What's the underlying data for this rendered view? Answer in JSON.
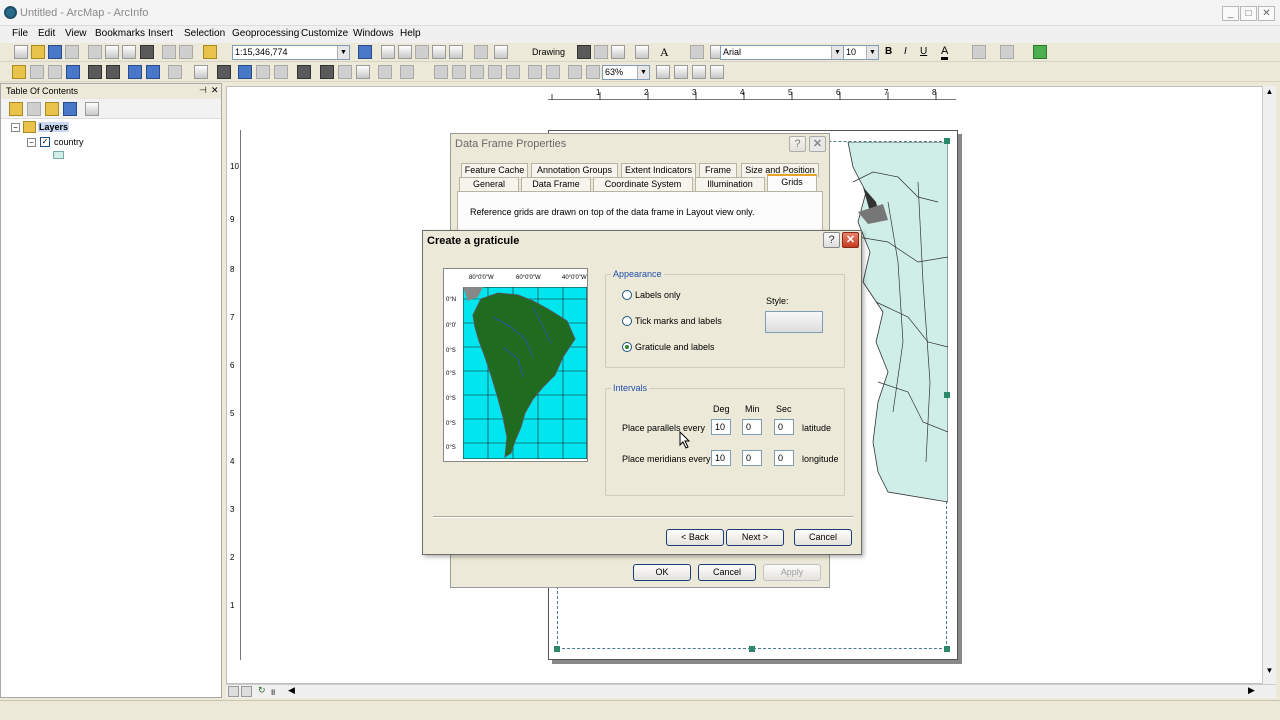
{
  "app": {
    "title": "Untitled - ArcMap - ArcInfo"
  },
  "menu": [
    "File",
    "Edit",
    "View",
    "Bookmarks",
    "Insert",
    "Selection",
    "Geoprocessing",
    "Customize",
    "Windows",
    "Help"
  ],
  "toolbar": {
    "scale": "1:15,346,774",
    "drawing_label": "Drawing",
    "font_name": "Arial",
    "font_size": "10",
    "bold": "B",
    "italic": "I",
    "underline": "U",
    "font_color_glyph": "A",
    "zoom_percent": "63%"
  },
  "toc": {
    "title": "Table Of Contents",
    "root_layer": "Layers",
    "layers": [
      {
        "name": "country",
        "checked": true
      }
    ]
  },
  "ruler_top_ticks": [
    "1",
    "2",
    "3",
    "4",
    "5",
    "6",
    "7",
    "8"
  ],
  "ruler_left_ticks": [
    "10",
    "9",
    "8",
    "7",
    "6",
    "5",
    "4",
    "3",
    "2",
    "1"
  ],
  "data_frame_properties": {
    "title": "Data Frame Properties",
    "tabs_row1": [
      "Feature Cache",
      "Annotation Groups",
      "Extent Indicators",
      "Frame",
      "Size and Position"
    ],
    "tabs_row2": [
      "General",
      "Data Frame",
      "Coordinate System",
      "Illumination",
      "Grids"
    ],
    "active_tab": "Grids",
    "description": "Reference grids are drawn on top of the data frame in Layout view only.",
    "buttons": {
      "ok": "OK",
      "cancel": "Cancel",
      "apply": "Apply"
    }
  },
  "graticule_dialog": {
    "title": "Create a graticule",
    "appearance_label": "Appearance",
    "options": [
      "Labels only",
      "Tick marks and labels",
      "Graticule and labels"
    ],
    "selected_option": "Graticule and labels",
    "style_label": "Style:",
    "intervals_label": "Intervals",
    "col_headers": [
      "Deg",
      "Min",
      "Sec"
    ],
    "parallels": {
      "label": "Place parallels every",
      "deg": "10",
      "min": "0",
      "sec": "0",
      "unit": "latitude"
    },
    "meridians": {
      "label": "Place meridians every",
      "deg": "10",
      "min": "0",
      "sec": "0",
      "unit": "longitude"
    },
    "thumbnail": {
      "top_labels": [
        "80°0'0\"W",
        "60°0'0\"W",
        "40°0'0\"W"
      ],
      "left_labels": [
        "0°N",
        "0°0'",
        "0°S",
        "0°S",
        "0°S",
        "0°S",
        "0°S"
      ]
    },
    "buttons": {
      "back": "< Back",
      "next": "Next >",
      "cancel": "Cancel"
    }
  },
  "colors": {
    "ocean": "#00e5ee",
    "land": "#1f6b1f",
    "dialog_bg": "#ece9d8",
    "group_label": "#1f4fa8",
    "close_button": "#c43c1e",
    "map_background": "#cfeee8"
  }
}
